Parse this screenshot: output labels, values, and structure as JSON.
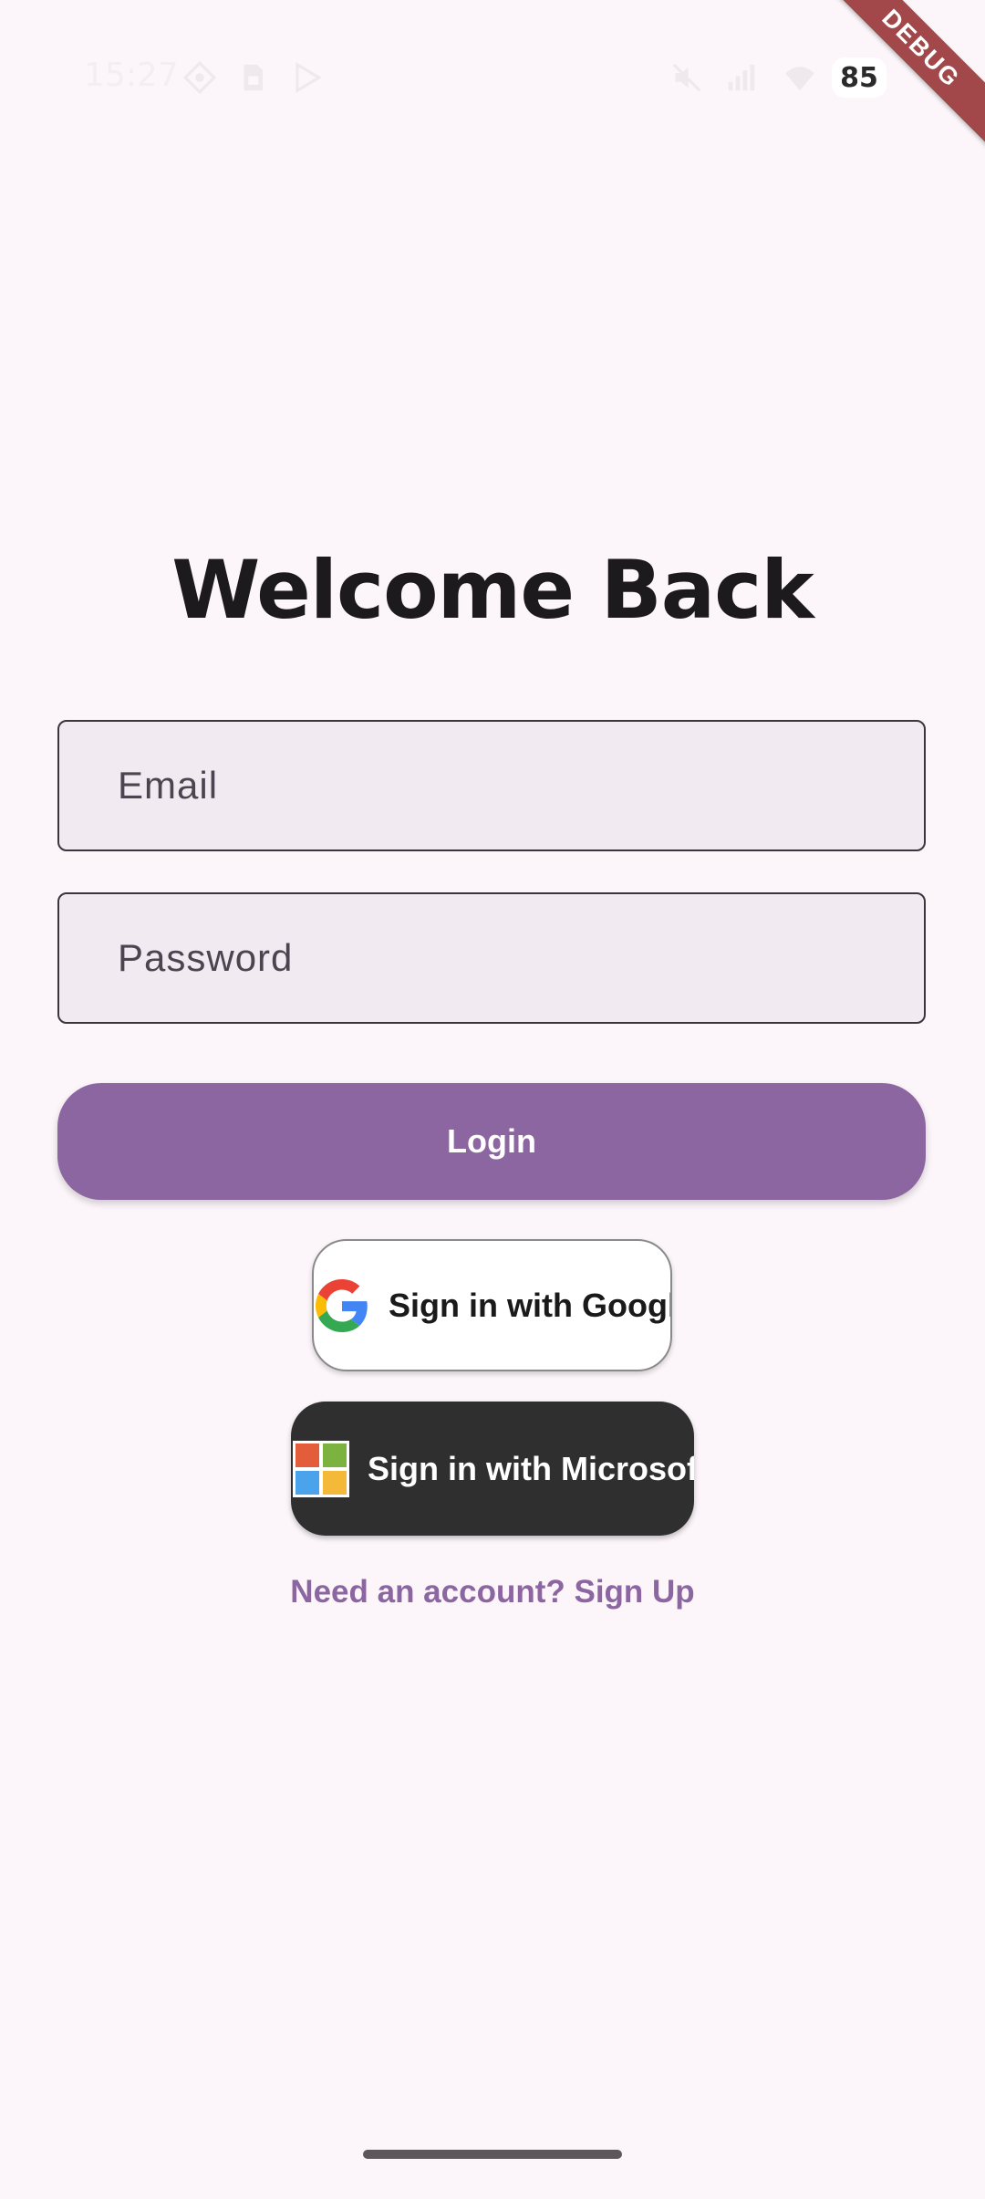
{
  "status_bar": {
    "time": "15:27",
    "battery": "85",
    "icons": [
      "location-icon",
      "sim-card-icon",
      "play-store-icon",
      "mute-icon",
      "signal-icon",
      "wifi-icon",
      "battery-icon"
    ]
  },
  "debug_banner": "DEBUG",
  "title": "Welcome Back",
  "form": {
    "email_placeholder": "Email",
    "email_value": "",
    "password_placeholder": "Password",
    "password_value": ""
  },
  "buttons": {
    "login": "Login",
    "google": "Sign in with Google",
    "microsoft": "Sign in with Microsoft"
  },
  "signup_link": "Need an account? Sign Up",
  "colors": {
    "background": "#fcf6fa",
    "accent": "#8c66a0",
    "microsoft_button_bg": "#2f2f2f",
    "debug_banner": "#a2474a",
    "field_background": "#f1ebf1"
  }
}
